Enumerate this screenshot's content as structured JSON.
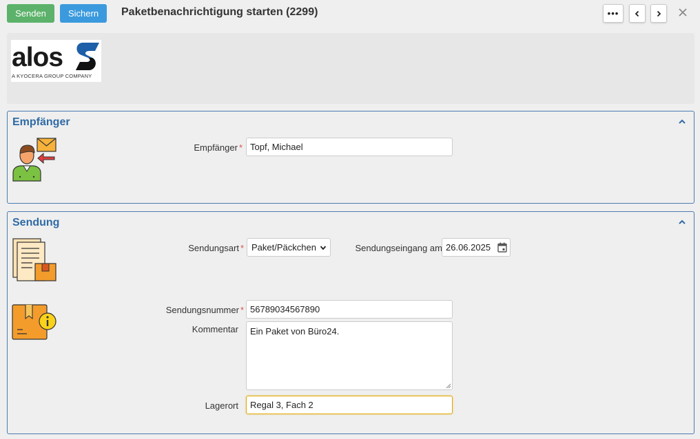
{
  "toolbar": {
    "send_label": "Senden",
    "save_label": "Sichern",
    "title": "Paketbenachrichtigung starten (2299)",
    "more_label": "•••"
  },
  "logo": {
    "text": "alos",
    "subtitle": "A KYOCERA GROUP COMPANY"
  },
  "sections": {
    "recipient": {
      "title": "Empfänger",
      "fields": {
        "recipient": {
          "label": "Empfänger",
          "required_mark": "*",
          "value": "Topf, Michael"
        }
      }
    },
    "shipment": {
      "title": "Sendung",
      "fields": {
        "type": {
          "label": "Sendungsart",
          "required_mark": "*",
          "value": "Paket/Päckchen"
        },
        "received": {
          "label": "Sendungseingang am",
          "required_mark": "*",
          "value": "26.06.2025"
        },
        "number": {
          "label": "Sendungsnummer",
          "required_mark": "*",
          "value": "56789034567890"
        },
        "comment": {
          "label": "Kommentar",
          "value": "Ein Paket von Büro24."
        },
        "location": {
          "label": "Lagerort",
          "value": "Regal 3, Fach 2"
        }
      }
    }
  },
  "colors": {
    "send_button": "#5cb26a",
    "save_button": "#3b9ade",
    "section_border": "#4a7bb0",
    "section_title": "#2f6aa5",
    "required": "#d9534f",
    "focus_border": "#e0a800"
  }
}
